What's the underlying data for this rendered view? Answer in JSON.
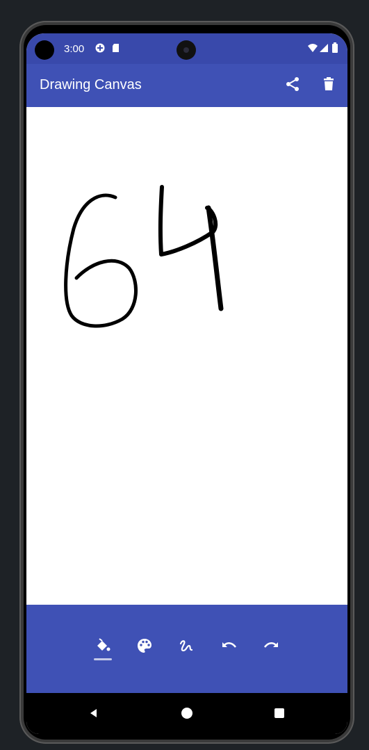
{
  "status_bar": {
    "time": "3:00",
    "icons": [
      "data-saver-icon",
      "sd-card-icon",
      "wifi-icon",
      "cell-signal-icon",
      "battery-icon"
    ]
  },
  "app_bar": {
    "title": "Drawing Canvas",
    "actions": [
      "share-icon",
      "delete-icon"
    ]
  },
  "canvas": {
    "background": "#ffffff",
    "stroke_color": "#000000",
    "drawn_content": "64"
  },
  "toolbar": {
    "tools": [
      "fill-bucket-icon",
      "palette-icon",
      "brush-stroke-icon",
      "undo-icon",
      "redo-icon"
    ],
    "active_tool": "fill-bucket-icon"
  },
  "nav_bar": {
    "buttons": [
      "back-icon",
      "home-icon",
      "recents-icon"
    ]
  },
  "colors": {
    "primary": "#3f51b5",
    "primary_dark": "#3949ab",
    "on_primary": "#ffffff"
  }
}
